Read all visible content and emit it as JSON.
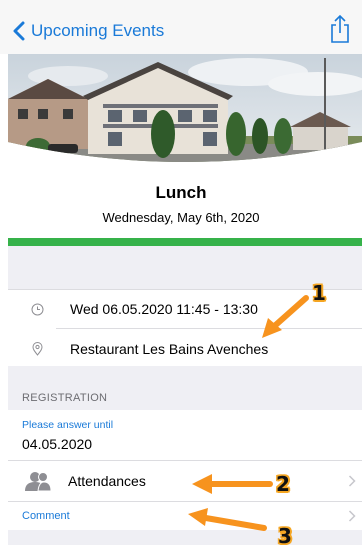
{
  "nav": {
    "back_label": "Upcoming Events"
  },
  "event": {
    "title": "Lunch",
    "date_long": "Wednesday, May 6th, 2020",
    "time_range": "Wed 06.05.2020 11:45 - 13:30",
    "location": "Restaurant Les Bains Avenches"
  },
  "registration": {
    "header": "REGISTRATION",
    "answer_label": "Please answer until",
    "answer_date": "04.05.2020",
    "attendances_label": "Attendances",
    "comment_label": "Comment"
  },
  "annotations": {
    "marker_1": "1",
    "marker_2": "2",
    "marker_3": "3"
  },
  "colors": {
    "accent": "#1a7ad8",
    "status_bar": "#36b24a",
    "annotation_arrow": "#f7931e"
  },
  "icons": {
    "back": "chevron-left-icon",
    "share": "share-icon",
    "time": "clock-icon",
    "location": "location-pin-icon",
    "attendances": "people-icon",
    "row_chevron": "chevron-right-icon"
  }
}
